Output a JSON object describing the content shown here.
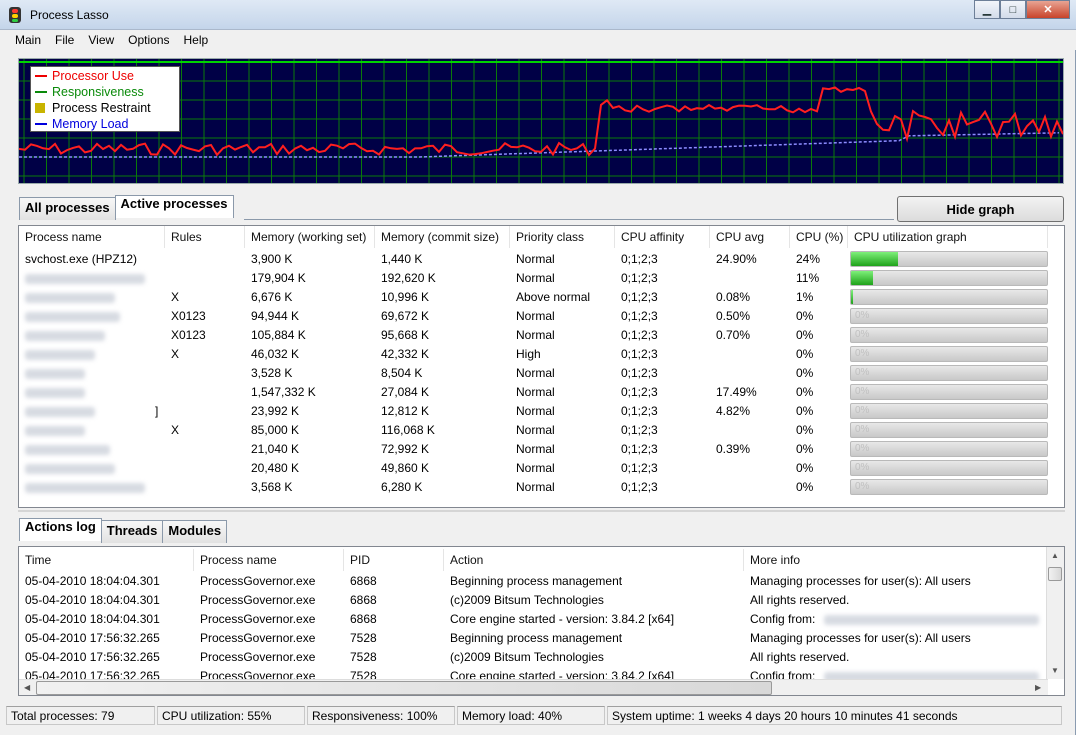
{
  "window": {
    "title": "Process Lasso"
  },
  "menu": [
    "Main",
    "File",
    "View",
    "Options",
    "Help"
  ],
  "legend": [
    {
      "label": "Processor Use",
      "color": "#ee0000",
      "style": "solid"
    },
    {
      "label": "Responsiveness",
      "color": "#0a8a0a",
      "style": "solid"
    },
    {
      "label": "Process Restraint",
      "color": "#c8b400",
      "style": "box"
    },
    {
      "label": "Memory Load",
      "color": "#0000dd",
      "style": "dashed"
    }
  ],
  "graph_colors": {
    "background": "#000046",
    "grid": "#0a7a0a",
    "cpu": "#ff1f1f",
    "memory": "#8c8cff",
    "responsiveness": "#00d400"
  },
  "process_tabs": [
    "All processes",
    "Active processes"
  ],
  "hide_graph_label": "Hide graph",
  "process_columns": [
    "Process name",
    "Rules",
    "Memory (working set)",
    "Memory (commit size)",
    "Priority class",
    "CPU affinity",
    "CPU avg",
    "CPU (%)",
    "CPU utilization graph"
  ],
  "processes": [
    {
      "name": "svchost.exe (HPZ12)",
      "rules": "",
      "ws": "3,900 K",
      "commit": "1,440 K",
      "priority": "Normal",
      "affinity": "0;1;2;3",
      "avg": "24.90%",
      "cpu": "24%",
      "util": 0.24
    },
    {
      "name": "",
      "rules": "",
      "ws": "179,904 K",
      "commit": "192,620 K",
      "priority": "Normal",
      "affinity": "0;1;2;3",
      "avg": "",
      "cpu": "11%",
      "util": 0.11
    },
    {
      "name": "",
      "rules": "X",
      "ws": "6,676 K",
      "commit": "10,996 K",
      "priority": "Above normal",
      "affinity": "0;1;2;3",
      "avg": "0.08%",
      "cpu": "1%",
      "util": 0.01
    },
    {
      "name": "",
      "rules": "X0123",
      "ws": "94,944 K",
      "commit": "69,672 K",
      "priority": "Normal",
      "affinity": "0;1;2;3",
      "avg": "0.50%",
      "cpu": "0%",
      "util": 0
    },
    {
      "name": "",
      "rules": "X0123",
      "ws": "105,884 K",
      "commit": "95,668 K",
      "priority": "Normal",
      "affinity": "0;1;2;3",
      "avg": "0.70%",
      "cpu": "0%",
      "util": 0
    },
    {
      "name": "",
      "rules": "X",
      "ws": "46,032 K",
      "commit": "42,332 K",
      "priority": "High",
      "affinity": "0;1;2;3",
      "avg": "",
      "cpu": "0%",
      "util": 0
    },
    {
      "name": "",
      "rules": "",
      "ws": "3,528 K",
      "commit": "8,504 K",
      "priority": "Normal",
      "affinity": "0;1;2;3",
      "avg": "",
      "cpu": "0%",
      "util": 0
    },
    {
      "name": "",
      "rules": "",
      "ws": "1,547,332 K",
      "commit": "27,084 K",
      "priority": "Normal",
      "affinity": "0;1;2;3",
      "avg": "17.49%",
      "cpu": "0%",
      "util": 0
    },
    {
      "name": "]",
      "rules": "",
      "ws": "23,992 K",
      "commit": "12,812 K",
      "priority": "Normal",
      "affinity": "0;1;2;3",
      "avg": "4.82%",
      "cpu": "0%",
      "util": 0
    },
    {
      "name": "",
      "rules": "X",
      "ws": "85,000 K",
      "commit": "116,068 K",
      "priority": "Normal",
      "affinity": "0;1;2;3",
      "avg": "",
      "cpu": "0%",
      "util": 0
    },
    {
      "name": "",
      "rules": "",
      "ws": "21,040 K",
      "commit": "72,992 K",
      "priority": "Normal",
      "affinity": "0;1;2;3",
      "avg": "0.39%",
      "cpu": "0%",
      "util": 0
    },
    {
      "name": "",
      "rules": "",
      "ws": "20,480 K",
      "commit": "49,860 K",
      "priority": "Normal",
      "affinity": "0;1;2;3",
      "avg": "",
      "cpu": "0%",
      "util": 0
    },
    {
      "name": "",
      "rules": "",
      "ws": "3,568 K",
      "commit": "6,280 K",
      "priority": "Normal",
      "affinity": "0;1;2;3",
      "avg": "",
      "cpu": "0%",
      "util": 0
    }
  ],
  "bar_text": "0%",
  "log_tabs": [
    "Actions log",
    "Threads",
    "Modules"
  ],
  "log_columns": [
    "Time",
    "Process name",
    "PID",
    "Action",
    "More info"
  ],
  "log": [
    {
      "time": "05-04-2010 18:04:04.301",
      "proc": "ProcessGovernor.exe",
      "pid": "6868",
      "action": "Beginning process management",
      "info": "Managing processes for user(s): All users"
    },
    {
      "time": "05-04-2010 18:04:04.301",
      "proc": "ProcessGovernor.exe",
      "pid": "6868",
      "action": "(c)2009 Bitsum Technologies",
      "info": "All rights reserved."
    },
    {
      "time": "05-04-2010 18:04:04.301",
      "proc": "ProcessGovernor.exe",
      "pid": "6868",
      "action": "Core engine started - version: 3.84.2 [x64]",
      "info": "Config from:"
    },
    {
      "time": "05-04-2010 17:56:32.265",
      "proc": "ProcessGovernor.exe",
      "pid": "7528",
      "action": "Beginning process management",
      "info": "Managing processes for user(s): All users"
    },
    {
      "time": "05-04-2010 17:56:32.265",
      "proc": "ProcessGovernor.exe",
      "pid": "7528",
      "action": "(c)2009 Bitsum Technologies",
      "info": "All rights reserved."
    },
    {
      "time": "05-04-2010 17:56:32.265",
      "proc": "ProcessGovernor.exe",
      "pid": "7528",
      "action": "Core engine started - version: 3.84.2 [x64]",
      "info": "Config from:"
    }
  ],
  "status": {
    "total": "Total processes: 79",
    "cpu": "CPU utilization: 55%",
    "resp": "Responsiveness: 100%",
    "mem": "Memory load: 40%",
    "uptime": "System uptime: 1 weeks 4 days 20 hours 10 minutes 41 seconds"
  }
}
